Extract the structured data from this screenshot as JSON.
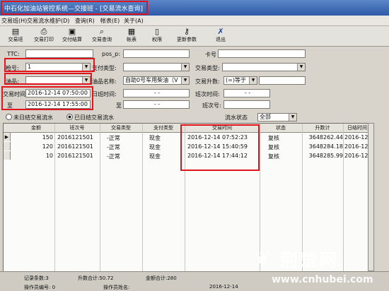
{
  "window": {
    "title": "中石化加油站管控系统—交接班 - [交易流水查询]"
  },
  "menu": [
    {
      "label": "交易班(H)"
    },
    {
      "label": "交易流水维护(D)"
    },
    {
      "label": "查询(R)"
    },
    {
      "label": "帐表(E)"
    },
    {
      "label": "关于(A)"
    }
  ],
  "toolbar": [
    {
      "label": "交易班",
      "icon": "document-icon"
    },
    {
      "label": "交易打印",
      "icon": "printer-icon"
    },
    {
      "label": "交付结算",
      "icon": "money-icon"
    },
    {
      "label": "交易查询",
      "icon": "search-icon"
    },
    {
      "label": "帐表",
      "icon": "table-icon"
    },
    {
      "label": "权限",
      "icon": "lock-icon"
    },
    {
      "label": "更新参数",
      "icon": "key-icon"
    },
    {
      "label": "退出",
      "icon": "exit-icon"
    }
  ],
  "filters": {
    "ttc_label": "TTC:",
    "pos_label": "pos_p:",
    "card_label": "卡号",
    "gun_label": "枪号:",
    "gun_value": "1",
    "payment_label": "支付类型:",
    "trade_type_label": "交易类型:",
    "oil_label": "油品:",
    "oil_name_label": "油品名称:",
    "oil_name_value": "自助0号车用柴油（V",
    "trade_amount_label": "交易升数:",
    "operator_value": "(=)等于",
    "time_label": "交易时间",
    "time_from": "2016-12-14 07:50:00",
    "to_label": "至",
    "time_to": "2016-12-14 17:55:00",
    "shift_time_label": "日班时间:",
    "shift_no_label": "班次时间:",
    "shift_label": "班次号:",
    "date_placeholder": "-  -"
  },
  "radios": {
    "unsettled": "未日结交易流水",
    "settled": "已日结交易流水",
    "status_label": "流水状态",
    "status_value": "全部"
  },
  "grid": {
    "columns": [
      "金额",
      "班次号",
      "交易类型",
      "支付类型",
      "交易时间",
      "状态",
      "升数计",
      "日结时间"
    ],
    "rows": [
      {
        "amount": "150",
        "shift": "2016121501",
        "trade_type": "-正常",
        "pay_type": "现金",
        "time": "2016-12-14 07:52:23",
        "status": "复核",
        "liters": "3648262.44",
        "settle_time": "2016-12"
      },
      {
        "amount": "120",
        "shift": "2016121501",
        "trade_type": "-正常",
        "pay_type": "现金",
        "time": "2016-12-14 15:40:59",
        "status": "复核",
        "liters": "3648284.18",
        "settle_time": "2016-12"
      },
      {
        "amount": "10",
        "shift": "2016121501",
        "trade_type": "-正常",
        "pay_type": "现金",
        "time": "2016-12-14 17:44:12",
        "status": "复核",
        "liters": "3648285.99",
        "settle_time": "2016-12"
      }
    ]
  },
  "status": {
    "records": "记录条数:3",
    "liters_total": "升数合计:50.72",
    "amount_total": "金额合计:280",
    "operator": "操作员编号: 0",
    "operator_name": "操作员姓名:",
    "date": "2016-12-14"
  },
  "watermark": {
    "text": "荆楚网",
    "url": "www.cnhubei.com"
  },
  "colors": {
    "annotation": "#e0141a",
    "titlebar": "#2e5aa8"
  }
}
